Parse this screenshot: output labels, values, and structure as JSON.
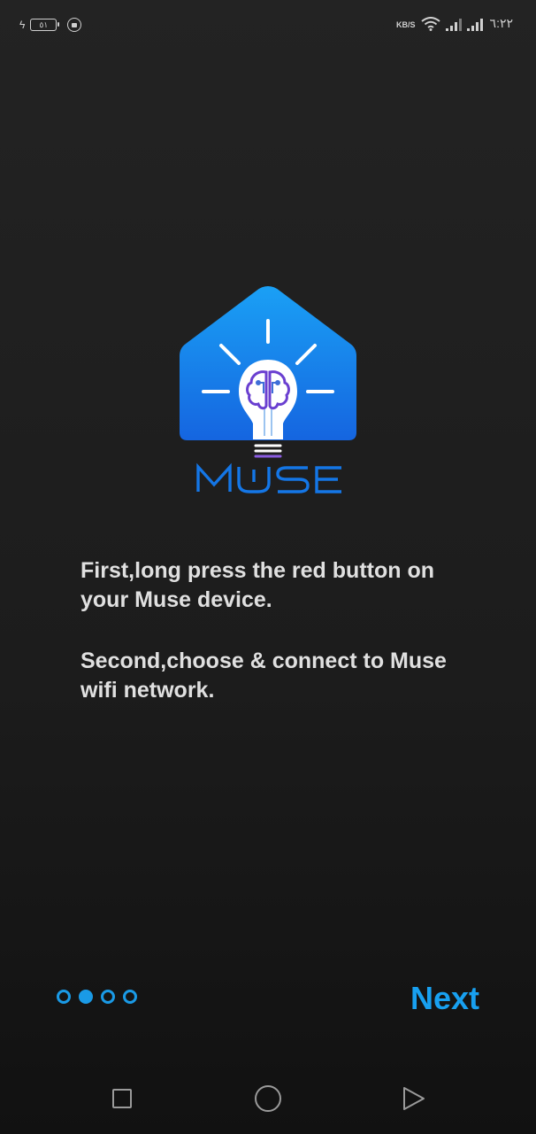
{
  "status_bar": {
    "battery_level": "٥١",
    "network_speed": "KB/S",
    "time": "٦:٢٢"
  },
  "logo": {
    "brand_text": "MUSE",
    "colors": {
      "house_top": "#1aa0f5",
      "house_bottom": "#1565e0",
      "wordmark": "#1476e6",
      "brain": "#6a3fd0"
    }
  },
  "instructions": {
    "step1": "First,long press the red button on your Muse device.",
    "step2": "Second,choose & connect to Muse wifi network."
  },
  "pager": {
    "total": 4,
    "current": 2
  },
  "footer": {
    "next_label": "Next"
  },
  "theme": {
    "accent": "#18a0f0",
    "background": "#1f1f1f"
  },
  "nav": {
    "icons": [
      "square-icon",
      "circle-icon",
      "triangle-icon"
    ]
  }
}
